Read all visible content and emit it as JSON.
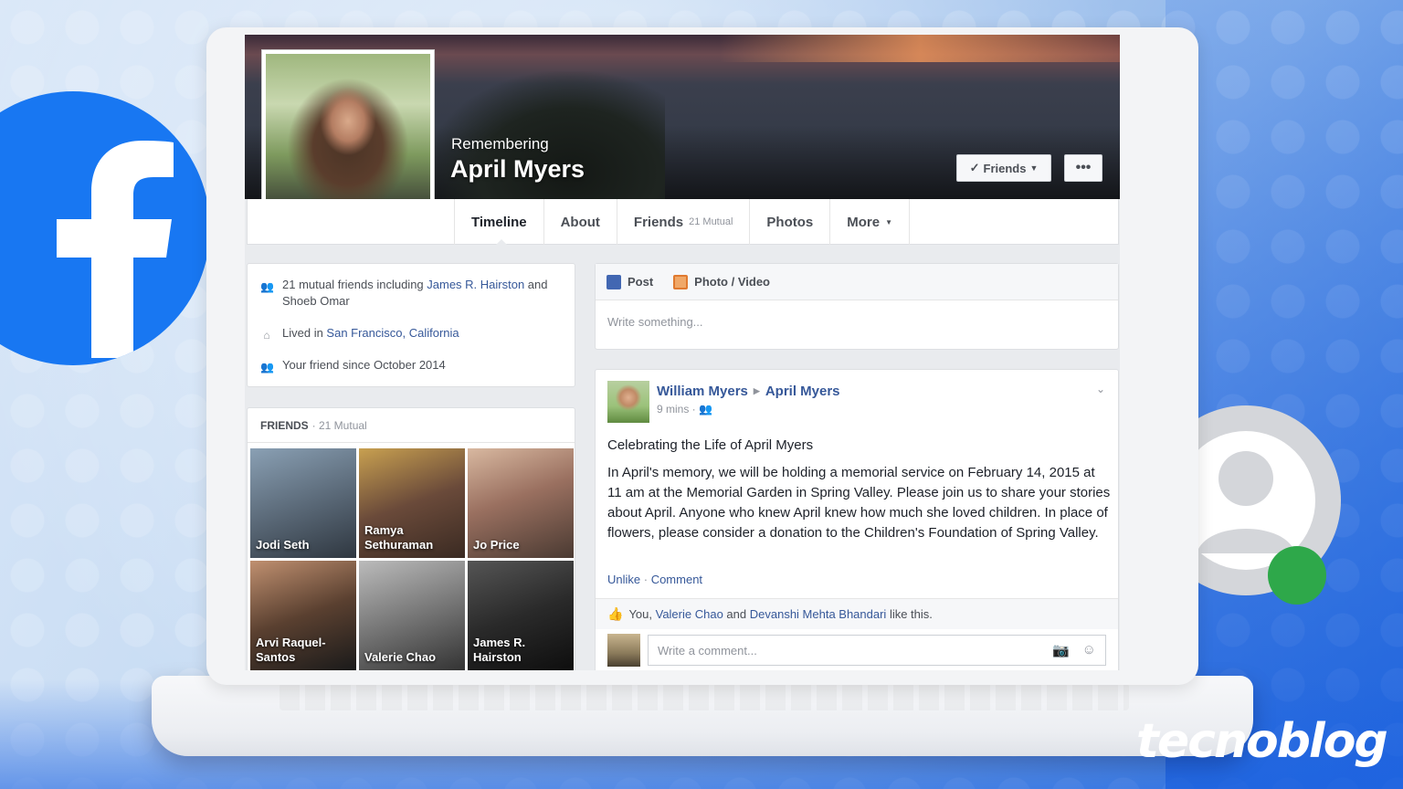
{
  "watermark": "tecnoblog",
  "profile": {
    "remembering": "Remembering",
    "name": "April Myers",
    "friends_button": "Friends",
    "more_button": "•••"
  },
  "tabs": [
    {
      "label": "Timeline",
      "extra": ""
    },
    {
      "label": "About",
      "extra": ""
    },
    {
      "label": "Friends",
      "extra": "21 Mutual"
    },
    {
      "label": "Photos",
      "extra": ""
    },
    {
      "label": "More",
      "extra": ""
    }
  ],
  "intro": {
    "mutual_prefix": "21 mutual friends including ",
    "mutual_link1": "James R. Hairston",
    "mutual_and": " and",
    "mutual_link2": "Shoeb Omar",
    "lived_prefix": "Lived in ",
    "lived_link": "San Francisco, California",
    "friend_since": "Your friend since October 2014"
  },
  "friends_card": {
    "heading": "FRIENDS",
    "count": "· 21 Mutual",
    "friends": [
      {
        "name": "Jodi Seth",
        "color": "#5c6b7a"
      },
      {
        "name": "Ramya Sethuraman",
        "color": "#6a4a3a"
      },
      {
        "name": "Jo Price",
        "color": "#7a5a4a"
      },
      {
        "name": "Arvi Raquel-Santos",
        "color": "#3a3a3a"
      },
      {
        "name": "Valerie Chao",
        "color": "#777777"
      },
      {
        "name": "James R. Hairston",
        "color": "#1e1e1e"
      }
    ]
  },
  "composer": {
    "post_tab": "Post",
    "photo_tab": "Photo / Video",
    "placeholder": "Write something..."
  },
  "post": {
    "author": "William Myers",
    "target": "April Myers",
    "time": "9 mins · ",
    "title": "Celebrating the Life of April Myers",
    "body": "In April's memory, we will be holding a memorial service on February 14, 2015 at 11 am at the Memorial Garden in Spring Valley. Please join us to share your stories about April. Anyone who knew April knew how much she loved children. In place of flowers, please consider a donation to the Children's Foundation of Spring Valley.",
    "unlike": "Unlike",
    "sep": " · ",
    "comment": "Comment",
    "likes_you": "You, ",
    "likes_name1": "Valerie Chao",
    "likes_and": " and ",
    "likes_name2": "Devanshi Mehta Bhandari",
    "likes_suffix": " like this.",
    "comment_placeholder": "Write a comment..."
  },
  "colors": {
    "facebook_blue": "#1877f2",
    "link": "#365899",
    "status_green": "#2ea84a"
  },
  "icons": {
    "facebook_logo": "facebook-f-icon",
    "account": "account-circle-icon",
    "camera": "camera-icon",
    "emoji": "emoji-icon",
    "thumbs_up": "thumbs-up-icon"
  }
}
